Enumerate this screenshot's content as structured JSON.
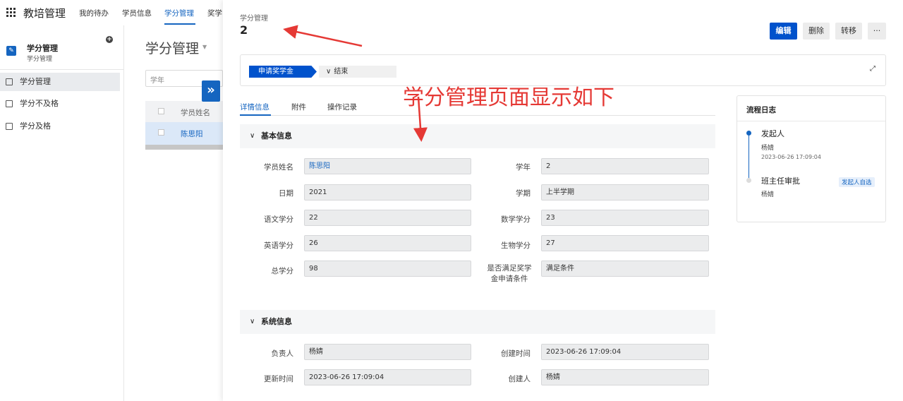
{
  "app": {
    "title": "教培管理"
  },
  "topnav": {
    "items": [
      "我的待办",
      "学员信息",
      "学分管理",
      "奖学"
    ],
    "active_index": 2
  },
  "sidebar": {
    "module_title": "学分管理",
    "module_subtitle": "学分管理",
    "items": [
      {
        "label": "学分管理",
        "active": true
      },
      {
        "label": "学分不及格",
        "active": false
      },
      {
        "label": "学分及格",
        "active": false
      }
    ]
  },
  "list": {
    "title": "学分管理",
    "search_placeholder": "学年",
    "column_header": "学员姓名",
    "rows": [
      "陈思阳"
    ]
  },
  "drawer": {
    "breadcrumb": "学分管理",
    "record_id": "2",
    "actions": {
      "edit": "编辑",
      "delete": "删除",
      "transfer": "转移",
      "more": "···"
    },
    "flow": {
      "step1": "申请奖学金",
      "step2": "结束"
    },
    "tabs": [
      "详情信息",
      "附件",
      "操作记录"
    ],
    "basic_section": {
      "title": "基本信息",
      "fields": [
        {
          "label": "学员姓名",
          "value": "陈思阳"
        },
        {
          "label": "学年",
          "value": "2"
        },
        {
          "label": "日期",
          "value": "2021"
        },
        {
          "label": "学期",
          "value": "上半学期"
        },
        {
          "label": "语文学分",
          "value": "22"
        },
        {
          "label": "数学学分",
          "value": "23"
        },
        {
          "label": "英语学分",
          "value": "26"
        },
        {
          "label": "生物学分",
          "value": "27"
        },
        {
          "label": "总学分",
          "value": "98"
        },
        {
          "label": "是否满足奖学金申请条件",
          "value": "满足条件"
        }
      ]
    },
    "system_section": {
      "title": "系统信息",
      "fields": [
        {
          "label": "负责人",
          "value": "杨婧"
        },
        {
          "label": "创建时间",
          "value": "2023-06-26 17:09:04"
        },
        {
          "label": "更新时间",
          "value": "2023-06-26 17:09:04"
        },
        {
          "label": "创建人",
          "value": "杨婧"
        }
      ]
    },
    "log": {
      "title": "流程日志",
      "entries": [
        {
          "name": "发起人",
          "user": "杨婧",
          "time": "2023-06-26 17:09:04"
        },
        {
          "name": "班主任审批",
          "user": "杨婧",
          "badge": "发起人自选"
        }
      ]
    }
  },
  "annotation": {
    "text": "学分管理页面显示如下",
    "color": "#e53935"
  },
  "colors": {
    "accent": "#1565c0",
    "primary_button": "#0052cc",
    "annotation": "#e53935"
  }
}
